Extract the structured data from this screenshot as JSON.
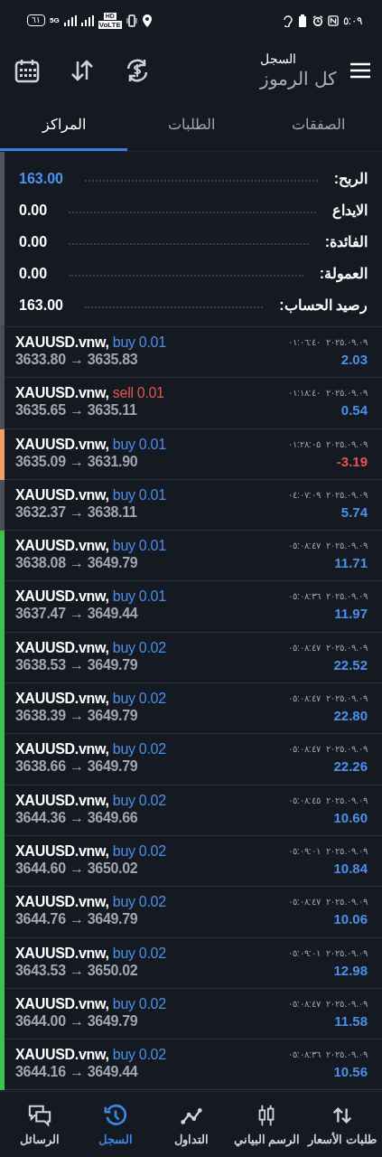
{
  "status_bar": {
    "time": "٥:٠٩",
    "battery": "٦١",
    "network": "5G",
    "hd": "HD",
    "volte": "VoLTE"
  },
  "header": {
    "title": "السجل",
    "subtitle": "كل الرموز"
  },
  "tabs": [
    {
      "label": "الصفقات",
      "selected": false
    },
    {
      "label": "الطلبات",
      "selected": false
    },
    {
      "label": "المراكز",
      "selected": true
    }
  ],
  "summary": [
    {
      "label": "الربح:",
      "value": "163.00",
      "kind": "profit"
    },
    {
      "label": "الايداع",
      "value": "0.00",
      "kind": "plain"
    },
    {
      "label": "الفائدة:",
      "value": "0.00",
      "kind": "plain"
    },
    {
      "label": "العمولة:",
      "value": "0.00",
      "kind": "plain"
    },
    {
      "label": "رصيد الحساب:",
      "value": "163.00",
      "kind": "plain"
    }
  ],
  "positions": [
    {
      "symbol": "XAUUSD.vnw,",
      "side": "buy 0.01",
      "kind": "buy",
      "prices": "3633.80 → 3635.83",
      "time": "٢٠٢٥.٠٩.٠٩ ٠١:٠٦:٤٠",
      "profit": "2.03",
      "negative": false,
      "color": "#4a4f57"
    },
    {
      "symbol": "XAUUSD.vnw,",
      "side": "sell 0.01",
      "kind": "sell",
      "prices": "3635.65 → 3635.11",
      "time": "٢٠٢٥.٠٩.٠٩ ٠١:١٨:٤٠",
      "profit": "0.54",
      "negative": false,
      "color": "#4a4f57"
    },
    {
      "symbol": "XAUUSD.vnw,",
      "side": "buy 0.01",
      "kind": "buy",
      "prices": "3635.09 → 3631.90",
      "time": "٢٠٢٥.٠٩.٠٩ ٠١:٢٨:٠٥",
      "profit": "-3.19",
      "negative": true,
      "color": "#f0a060"
    },
    {
      "symbol": "XAUUSD.vnw,",
      "side": "buy 0.01",
      "kind": "buy",
      "prices": "3632.37 → 3638.11",
      "time": "٢٠٢٥.٠٩.٠٩ ٠٤:٠٧:٠٩",
      "profit": "5.74",
      "negative": false,
      "color": "#4a4f57"
    },
    {
      "symbol": "XAUUSD.vnw,",
      "side": "buy 0.01",
      "kind": "buy",
      "prices": "3638.08 → 3649.79",
      "time": "٢٠٢٥.٠٩.٠٩ ٠٥:٠٨:٤٧",
      "profit": "11.71",
      "negative": false,
      "color": "#3cc251"
    },
    {
      "symbol": "XAUUSD.vnw,",
      "side": "buy 0.01",
      "kind": "buy",
      "prices": "3637.47 → 3649.44",
      "time": "٢٠٢٥.٠٩.٠٩ ٠٥:٠٨:٣٦",
      "profit": "11.97",
      "negative": false,
      "color": "#3cc251"
    },
    {
      "symbol": "XAUUSD.vnw,",
      "side": "buy 0.02",
      "kind": "buy",
      "prices": "3638.53 → 3649.79",
      "time": "٢٠٢٥.٠٩.٠٩ ٠٥:٠٨:٤٧",
      "profit": "22.52",
      "negative": false,
      "color": "#3cc251"
    },
    {
      "symbol": "XAUUSD.vnw,",
      "side": "buy 0.02",
      "kind": "buy",
      "prices": "3638.39 → 3649.79",
      "time": "٢٠٢٥.٠٩.٠٩ ٠٥:٠٨:٤٧",
      "profit": "22.80",
      "negative": false,
      "color": "#3cc251"
    },
    {
      "symbol": "XAUUSD.vnw,",
      "side": "buy 0.02",
      "kind": "buy",
      "prices": "3638.66 → 3649.79",
      "time": "٢٠٢٥.٠٩.٠٩ ٠٥:٠٨:٤٧",
      "profit": "22.26",
      "negative": false,
      "color": "#3cc251"
    },
    {
      "symbol": "XAUUSD.vnw,",
      "side": "buy 0.02",
      "kind": "buy",
      "prices": "3644.36 → 3649.66",
      "time": "٢٠٢٥.٠٩.٠٩ ٠٥:٠٨:٤٥",
      "profit": "10.60",
      "negative": false,
      "color": "#3cc251"
    },
    {
      "symbol": "XAUUSD.vnw,",
      "side": "buy 0.02",
      "kind": "buy",
      "prices": "3644.60 → 3650.02",
      "time": "٢٠٢٥.٠٩.٠٩ ٠٥:٠٩:٠١",
      "profit": "10.84",
      "negative": false,
      "color": "#3cc251"
    },
    {
      "symbol": "XAUUSD.vnw,",
      "side": "buy 0.02",
      "kind": "buy",
      "prices": "3644.76 → 3649.79",
      "time": "٢٠٢٥.٠٩.٠٩ ٠٥:٠٨:٤٧",
      "profit": "10.06",
      "negative": false,
      "color": "#3cc251"
    },
    {
      "symbol": "XAUUSD.vnw,",
      "side": "buy 0.02",
      "kind": "buy",
      "prices": "3643.53 → 3650.02",
      "time": "٢٠٢٥.٠٩.٠٩ ٠٥:٠٩:٠١",
      "profit": "12.98",
      "negative": false,
      "color": "#3cc251"
    },
    {
      "symbol": "XAUUSD.vnw,",
      "side": "buy 0.02",
      "kind": "buy",
      "prices": "3644.00 → 3649.79",
      "time": "٢٠٢٥.٠٩.٠٩ ٠٥:٠٨:٤٧",
      "profit": "11.58",
      "negative": false,
      "color": "#3cc251"
    },
    {
      "symbol": "XAUUSD.vnw,",
      "side": "buy 0.02",
      "kind": "buy",
      "prices": "3644.16 → 3649.44",
      "time": "٢٠٢٥.٠٩.٠٩ ٠٥:٠٨:٣٦",
      "profit": "10.56",
      "negative": false,
      "color": "#3cc251"
    }
  ],
  "nav": [
    {
      "label": "طلبات الأسعار",
      "kind": "quotes",
      "selected": false
    },
    {
      "label": "الرسم البياني",
      "kind": "chart",
      "selected": false
    },
    {
      "label": "التداول",
      "kind": "trade",
      "selected": false
    },
    {
      "label": "السجل",
      "kind": "history",
      "selected": true
    },
    {
      "label": "الرسائل",
      "kind": "messages",
      "selected": false
    }
  ]
}
